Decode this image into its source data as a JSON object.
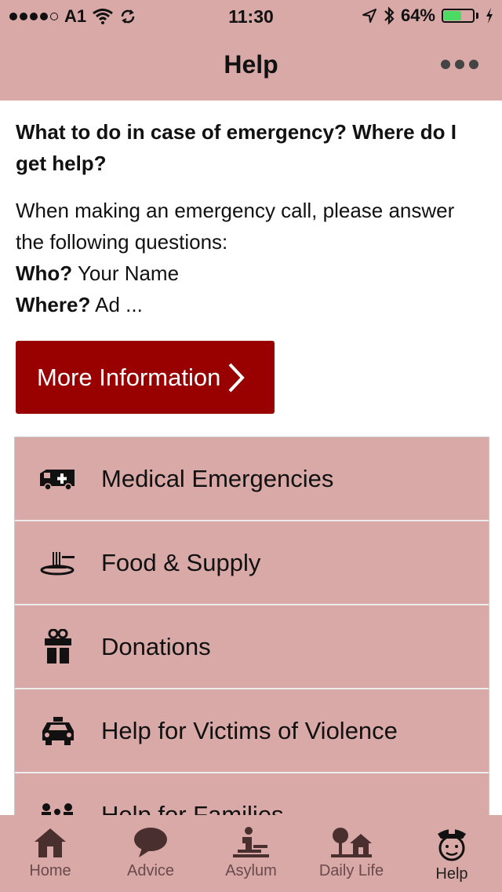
{
  "status_bar": {
    "carrier": "A1",
    "time": "11:30",
    "battery": "64%",
    "battery_level": 0.64
  },
  "nav": {
    "title": "Help"
  },
  "content": {
    "question": "What to do in case of emergency? Where do I get help?",
    "intro": "When making an emergency call, please answer the following questions:",
    "who_label": "Who?",
    "who_value": " Your Name",
    "where_label": "Where?",
    "where_value": " Ad ...",
    "more_button": "More Information"
  },
  "list": [
    {
      "label": "Medical Emergencies",
      "icon": "ambulance-icon"
    },
    {
      "label": "Food & Supply",
      "icon": "food-icon"
    },
    {
      "label": "Donations",
      "icon": "gift-icon"
    },
    {
      "label": "Help for Victims of Violence",
      "icon": "police-car-icon"
    },
    {
      "label": "Help for Families",
      "icon": "family-icon"
    }
  ],
  "tabs": [
    {
      "label": "Home",
      "icon": "home-icon"
    },
    {
      "label": "Advice",
      "icon": "speech-bubble-icon"
    },
    {
      "label": "Asylum",
      "icon": "asylum-icon"
    },
    {
      "label": "Daily Life",
      "icon": "daily-life-icon"
    },
    {
      "label": "Help",
      "icon": "police-officer-icon",
      "active": true
    }
  ],
  "colors": {
    "bar": "#d8a9a7",
    "accent_button": "#990000",
    "battery_green": "#4cd964"
  }
}
